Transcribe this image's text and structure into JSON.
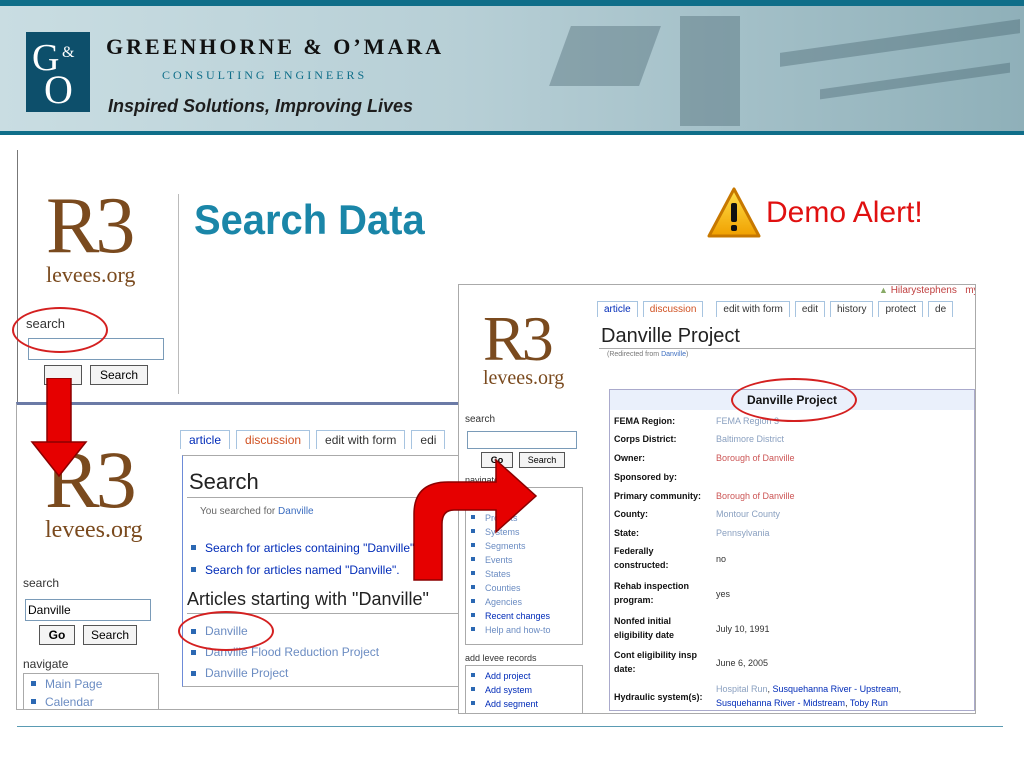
{
  "header": {
    "logo_g": "G",
    "logo_amp": "&",
    "logo_o": "O",
    "company": "GREENHORNE & O’MARA",
    "subtitle": "CONSULTING ENGINEERS",
    "tagline": "Inspired Solutions, Improving Lives"
  },
  "slide": {
    "title": "Search Data",
    "demo_alert": "Demo Alert!",
    "colors": {
      "title": "#1a86a8",
      "alert": "#e01010",
      "annotation": "#d42020",
      "header_band": "#0f6e89"
    }
  },
  "window1": {
    "logo_big": "R3",
    "logo_small": "levees.org",
    "search_label": "search",
    "search_value": "",
    "go_label": "",
    "search_button": "Search"
  },
  "window2": {
    "logo_big": "R3",
    "logo_small": "levees.org",
    "tabs": [
      "article",
      "discussion",
      "edit with form",
      "edi"
    ],
    "heading": "Search",
    "searched_prefix": "You searched for ",
    "searched_term": "Danville",
    "search_links": [
      "Search for articles containing \"Danville\"",
      "Search for articles named \"Danville\"."
    ],
    "subheading": "Articles starting with \"Danville\"",
    "articles": [
      "Danville",
      "Danville Flood Reduction Project",
      "Danville Project"
    ],
    "search_label": "search",
    "search_value": "Danville",
    "go_label": "Go",
    "search_button": "Search",
    "navigate_label": "navigate",
    "nav_items": [
      "Main Page",
      "Calendar"
    ]
  },
  "window3": {
    "logo_big": "R3",
    "logo_small": "levees.org",
    "user": "Hilarystephens",
    "user_extra": "my ta",
    "tabs": [
      "article",
      "discussion",
      "edit with form",
      "edit",
      "history",
      "protect",
      "de"
    ],
    "heading": "Danville Project",
    "redirect_prefix": "(Redirected from ",
    "redirect_link": "Danville",
    "redirect_suffix": ")",
    "search_label": "search",
    "go_label": "Go",
    "search_button": "Search",
    "navigate_label": "navigate",
    "nav_items": [
      "Calendar",
      "Projects",
      "Systems",
      "Segments",
      "Events",
      "States",
      "Counties",
      "Agencies",
      "Recent changes",
      "Help and how-to"
    ],
    "add_label": "add levee records",
    "add_items": [
      "Add project",
      "Add system",
      "Add segment"
    ],
    "infobox_title": "Danville Project",
    "rows": [
      {
        "key": "FEMA Region:",
        "value": "FEMA Region 3",
        "style": "grey"
      },
      {
        "key": "Corps District:",
        "value": "Baltimore District",
        "style": "grey"
      },
      {
        "key": "Owner:",
        "value": "Borough of Danville",
        "style": "link"
      },
      {
        "key": "Sponsored by:",
        "value": "",
        "style": "plain"
      },
      {
        "key": "Primary community:",
        "value": "Borough of Danville",
        "style": "link"
      },
      {
        "key": "County:",
        "value": "Montour County",
        "style": "grey"
      },
      {
        "key": "State:",
        "value": "Pennsylvania",
        "style": "grey"
      },
      {
        "key": "Federally constructed:",
        "value": "no",
        "style": "plain"
      },
      {
        "key": "Rehab inspection program:",
        "value": "yes",
        "style": "plain"
      },
      {
        "key": "Nonfed initial eligibility date",
        "value": "July 10, 1991",
        "style": "plain"
      },
      {
        "key": "Cont eligibility insp date:",
        "value": "June 6, 2005",
        "style": "plain"
      }
    ],
    "hydraulic_key": "Hydraulic system(s):",
    "hydraulic_parts": [
      "Hospital Run",
      ", ",
      "Susquehanna River - Upstream",
      ",",
      "Susquehanna River - Midstream",
      ", ",
      "Toby Run"
    ]
  }
}
